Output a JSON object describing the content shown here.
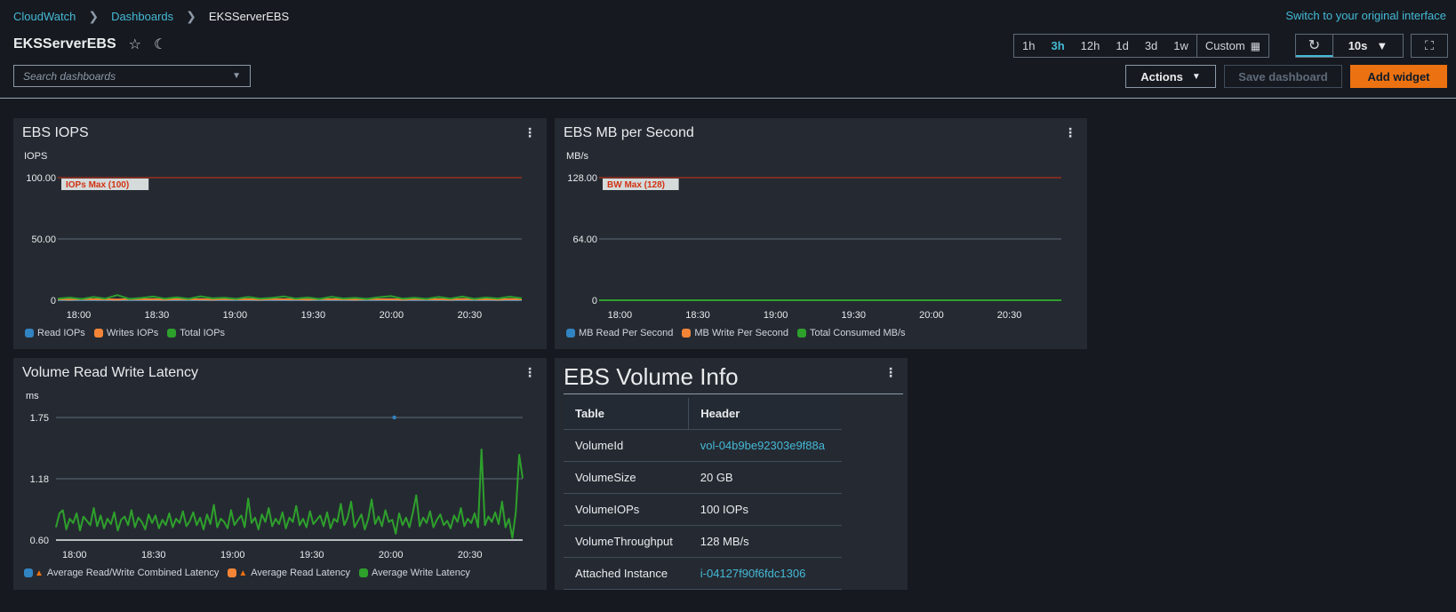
{
  "breadcrumb": {
    "items": [
      "CloudWatch",
      "Dashboards"
    ],
    "current": "EKSServerEBS"
  },
  "switch_link": "Switch to your original interface",
  "dashboard": {
    "title": "EKSServerEBS"
  },
  "time_range": {
    "options": [
      "1h",
      "3h",
      "12h",
      "1d",
      "3d",
      "1w"
    ],
    "active": "3h",
    "custom": "Custom"
  },
  "refresh": {
    "interval": "10s"
  },
  "search": {
    "placeholder": "Search dashboards"
  },
  "buttons": {
    "actions": "Actions",
    "save": "Save dashboard",
    "add_widget": "Add widget"
  },
  "colors": {
    "accent": "#44b9d6",
    "primary_button": "#ec7211",
    "series_blue": "#3184c2",
    "series_orange": "#f58536",
    "series_green": "#2ea02c",
    "threshold": "#d13212"
  },
  "widgets": {
    "iops": {
      "title": "EBS IOPS",
      "unit": "IOPS",
      "threshold_label": "IOPs Max (100)",
      "legend": [
        "Read IOPs",
        "Writes IOPs",
        "Total IOPs"
      ]
    },
    "mbps": {
      "title": "EBS MB per Second",
      "unit": "MB/s",
      "threshold_label": "BW Max (128)",
      "legend": [
        "MB Read Per Second",
        "MB Write Per Second",
        "Total Consumed MB/s"
      ]
    },
    "latency": {
      "title": "Volume Read Write Latency",
      "unit": "ms",
      "legend": [
        "Average Read/Write Combined Latency",
        "Average Read Latency",
        "Average Write Latency"
      ]
    },
    "info": {
      "title": "EBS Volume Info",
      "headers": [
        "Table",
        "Header"
      ],
      "rows": [
        {
          "label": "VolumeId",
          "value": "vol-04b9be92303e9f88a",
          "link": true
        },
        {
          "label": "VolumeSize",
          "value": "20 GB",
          "link": false
        },
        {
          "label": "VolumeIOPs",
          "value": "100 IOPs",
          "link": false
        },
        {
          "label": "VolumeThroughput",
          "value": "128 MB/s",
          "link": false
        },
        {
          "label": "Attached Instance",
          "value": "i-04127f90f6fdc1306",
          "link": true
        }
      ]
    }
  },
  "chart_data": [
    {
      "type": "line",
      "title": "EBS IOPS",
      "ylabel": "IOPS",
      "ylim": [
        0,
        100
      ],
      "yticks": [
        "100.00",
        "50.00",
        "0"
      ],
      "xticks": [
        "18:00",
        "18:30",
        "19:00",
        "19:30",
        "20:00",
        "20:30"
      ],
      "x_start": "17:52",
      "x_end": "20:50",
      "threshold": {
        "value": 100,
        "label": "IOPs Max (100)"
      },
      "series": [
        {
          "name": "Read IOPs",
          "color": "#3184c2",
          "values": [
            0.3,
            0.2,
            0.3,
            0.2,
            0.3,
            0.2,
            0.3,
            0.2,
            0.3,
            0.2,
            0.3,
            0.2,
            0.3,
            0.2,
            0.3,
            0.2,
            0.3,
            0.2,
            0.3,
            0.2,
            0.3,
            0.2,
            0.3,
            0.2,
            0.3,
            0.2,
            0.3,
            0.2,
            0.3,
            0.2,
            0.3,
            0.2,
            0.3,
            0.2,
            0.3,
            0.2,
            0.3,
            0.2,
            0.3,
            0.2
          ]
        },
        {
          "name": "Writes IOPs",
          "color": "#f58536",
          "values": [
            0.8,
            0.6,
            0.9,
            0.7,
            0.8,
            0.6,
            0.9,
            0.7,
            0.8,
            0.6,
            0.9,
            0.7,
            0.8,
            0.6,
            0.9,
            0.7,
            0.8,
            0.6,
            0.9,
            0.7,
            0.8,
            0.6,
            0.9,
            0.7,
            0.8,
            0.6,
            0.9,
            0.7,
            0.8,
            0.6,
            0.9,
            0.7,
            0.8,
            0.6,
            0.9,
            0.7,
            0.8,
            0.6,
            0.9,
            0.7
          ]
        },
        {
          "name": "Total IOPs",
          "color": "#2ea02c",
          "values": [
            1.2,
            2.1,
            1.0,
            2.6,
            1.3,
            4.2,
            1.1,
            1.8,
            3.0,
            1.2,
            2.4,
            1.1,
            3.2,
            1.5,
            2.0,
            1.1,
            2.6,
            1.2,
            1.9,
            3.1,
            1.2,
            2.2,
            1.0,
            2.8,
            1.4,
            1.9,
            1.1,
            2.5,
            3.3,
            1.2,
            2.0,
            1.1,
            2.7,
            1.3,
            3.0,
            1.1,
            2.2,
            1.4,
            2.9,
            1.5
          ]
        }
      ]
    },
    {
      "type": "line",
      "title": "EBS MB per Second",
      "ylabel": "MB/s",
      "ylim": [
        0,
        128
      ],
      "yticks": [
        "128.00",
        "64.00",
        "0"
      ],
      "xticks": [
        "18:00",
        "18:30",
        "19:00",
        "19:30",
        "20:00",
        "20:30"
      ],
      "x_start": "17:52",
      "x_end": "20:50",
      "threshold": {
        "value": 128,
        "label": "BW Max (128)"
      },
      "series": [
        {
          "name": "MB Read Per Second",
          "color": "#3184c2",
          "values": [
            0,
            0,
            0,
            0,
            0,
            0,
            0,
            0,
            0,
            0
          ]
        },
        {
          "name": "MB Write Per Second",
          "color": "#f58536",
          "values": [
            0.01,
            0.01,
            0.01,
            0.01,
            0.01,
            0.01,
            0.01,
            0.01,
            0.01,
            0.01
          ]
        },
        {
          "name": "Total Consumed MB/s",
          "color": "#2ea02c",
          "values": [
            0.02,
            0.02,
            0.02,
            0.02,
            0.02,
            0.02,
            0.02,
            0.02,
            0.02,
            0.02
          ]
        }
      ]
    },
    {
      "type": "line",
      "title": "Volume Read Write Latency",
      "ylabel": "ms",
      "ylim": [
        0.6,
        1.75
      ],
      "yticks": [
        "1.75",
        "1.18",
        "0.60"
      ],
      "xticks": [
        "18:00",
        "18:30",
        "19:00",
        "19:30",
        "20:00",
        "20:30"
      ],
      "x_start": "17:53",
      "x_end": "20:50",
      "series": [
        {
          "name": "Average Read/Write Combined Latency",
          "color": "#3184c2",
          "points": [
            [
              0.725,
              1.75
            ]
          ]
        },
        {
          "name": "Average Read Latency",
          "color": "#f58536",
          "values": []
        },
        {
          "name": "Average Write Latency",
          "color": "#2ea02c",
          "values": [
            0.72,
            0.85,
            0.88,
            0.7,
            0.8,
            0.76,
            0.85,
            0.69,
            0.82,
            0.78,
            0.74,
            0.9,
            0.73,
            0.83,
            0.71,
            0.8,
            0.75,
            0.86,
            0.69,
            0.79,
            0.82,
            0.74,
            0.88,
            0.72,
            0.81,
            0.77,
            0.7,
            0.84,
            0.76,
            0.83,
            0.71,
            0.79,
            0.74,
            0.85,
            0.72,
            0.8,
            0.76,
            0.87,
            0.73,
            0.78,
            0.86,
            0.74,
            0.81,
            0.7,
            0.84,
            0.75,
            0.93,
            0.72,
            0.8,
            0.77,
            0.71,
            0.88,
            0.74,
            0.79,
            0.83,
            0.72,
            0.99,
            0.76,
            0.81,
            0.7,
            0.84,
            0.77,
            0.9,
            0.73,
            0.8,
            0.75,
            0.86,
            0.71,
            0.81,
            0.77,
            0.92,
            0.74,
            0.8,
            0.72,
            0.87,
            0.75,
            0.79,
            0.83,
            0.73,
            0.86,
            0.71,
            0.8,
            0.77,
            0.94,
            0.74,
            0.81,
            0.96,
            0.72,
            0.78,
            0.84,
            0.7,
            0.8,
            0.98,
            0.75,
            0.82,
            0.73,
            0.88,
            0.77,
            0.79,
            0.66,
            0.85,
            0.74,
            0.81,
            0.72,
            0.86,
            1.02,
            0.73,
            0.81,
            0.76,
            0.87,
            0.72,
            0.79,
            0.84,
            0.74,
            0.78,
            0.71,
            0.83,
            0.77,
            0.9,
            0.73,
            0.8,
            0.76,
            0.85,
            0.72,
            1.45,
            0.74,
            0.82,
            0.77,
            0.86,
            0.75,
            0.96,
            0.72,
            0.8,
            0.62,
            0.86,
            1.4,
            1.18
          ]
        }
      ]
    }
  ]
}
